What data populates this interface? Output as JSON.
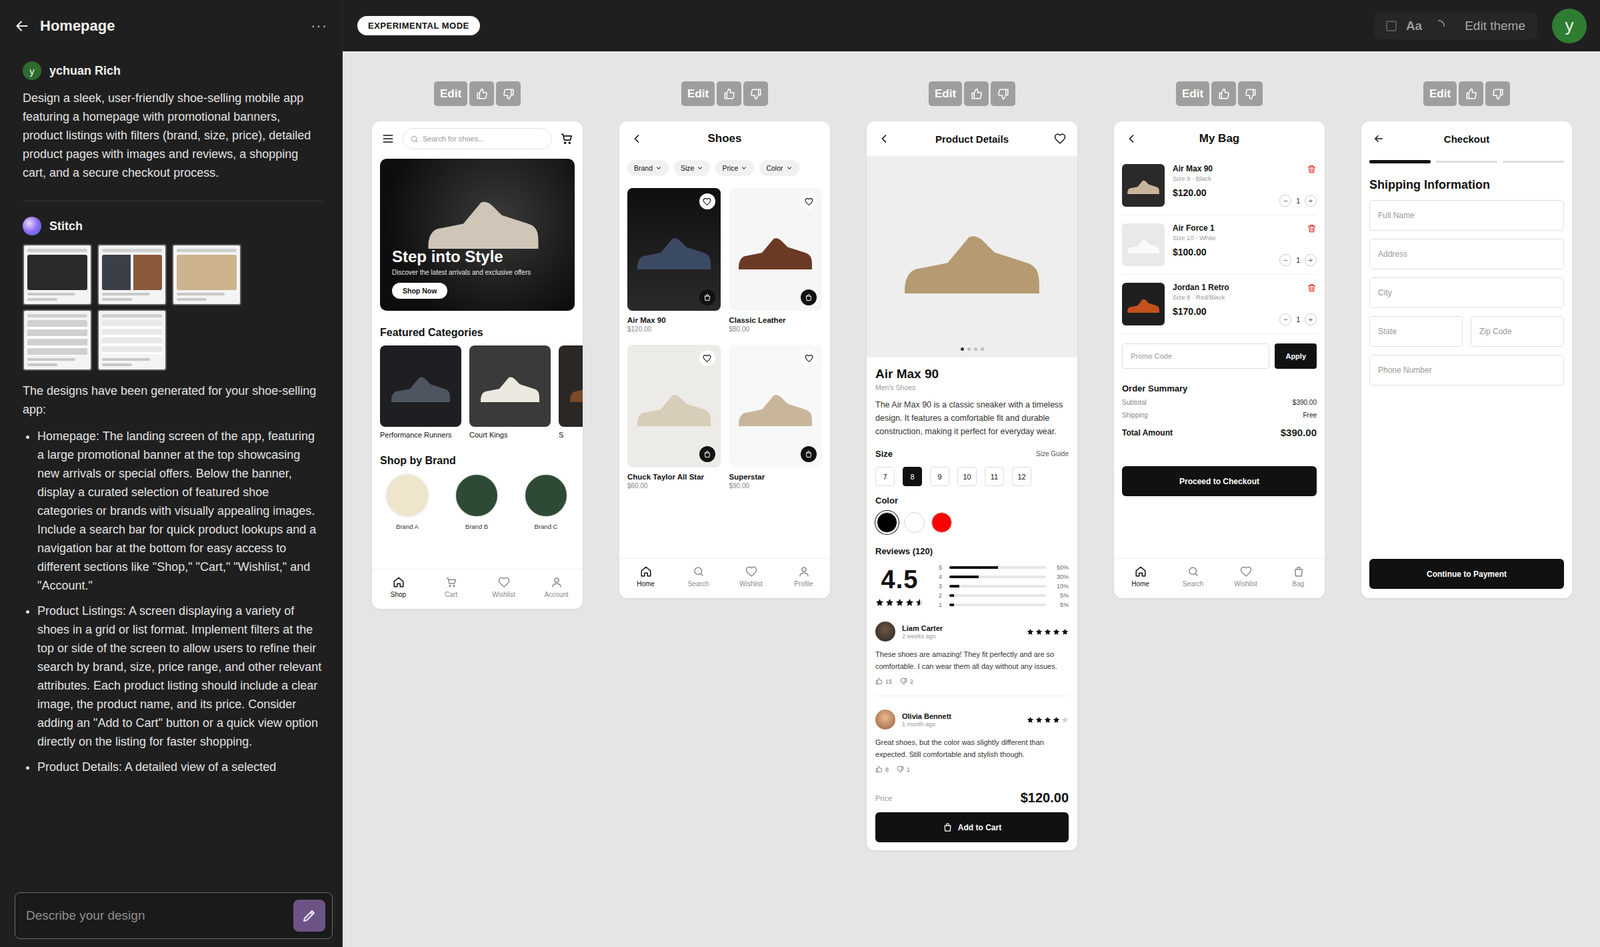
{
  "sidebar": {
    "title": "Homepage",
    "menu": "···",
    "user": {
      "avatar": "y",
      "name": "ychuan Rich",
      "prompt": "Design a sleek, user-friendly shoe-selling mobile app featuring a homepage with promotional banners, product listings with filters (brand, size, price), detailed product pages with images and reviews, a shopping cart, and a secure checkout process."
    },
    "assistant": {
      "name": "Stitch",
      "intro": "The designs have been generated for your shoe-selling app:",
      "bullets": [
        "Homepage: The landing screen of the app, featuring a large promotional banner at the top showcasing new arrivals or special offers. Below the banner, display a curated selection of featured shoe categories or brands with visually appealing images. Include a search bar for quick product lookups and a navigation bar at the bottom for easy access to different sections like \"Shop,\" \"Cart,\" \"Wishlist,\" and \"Account.\"",
        "Product Listings: A screen displaying a variety of shoes in a grid or list format. Implement filters at the top or side of the screen to allow users to refine their search by brand, size, price range, and other relevant attributes. Each product listing should include a clear image, the product name, and its price. Consider adding an \"Add to Cart\" button or a quick view option directly on the listing for faster shopping.",
        "Product Details: A detailed view of a selected"
      ]
    },
    "input": {
      "placeholder": "Describe your design"
    }
  },
  "topbar": {
    "badge": "EXPERIMENTAL MODE",
    "font_button": "Aa",
    "edit_theme": "Edit theme",
    "avatar": "y"
  },
  "screens": [
    {
      "kind": "home",
      "edit": "Edit",
      "search_placeholder": "Search for shoes...",
      "banner": {
        "title": "Step into Style",
        "subtitle": "Discover the latest arrivals and exclusive offers",
        "button": "Shop Now"
      },
      "categories_title": "Featured Categories",
      "categories": [
        {
          "name": "Performance Runners"
        },
        {
          "name": "Court Kings"
        },
        {
          "name": "S"
        }
      ],
      "brands_title": "Shop by Brand",
      "brands": [
        {
          "name": "Brand A",
          "color": "#efe4cc"
        },
        {
          "name": "Brand B",
          "color": "#2f4a34"
        },
        {
          "name": "Brand C",
          "color": "#2f4a34"
        }
      ],
      "nav": [
        {
          "label": "Shop",
          "kind": "home",
          "selected": true
        },
        {
          "label": "Cart",
          "kind": "cart",
          "selected": false
        },
        {
          "label": "Wishlist",
          "kind": "wishlist",
          "selected": false
        },
        {
          "label": "Account",
          "kind": "account",
          "selected": false
        }
      ]
    },
    {
      "kind": "listing",
      "edit": "Edit",
      "title": "Shoes",
      "filters": [
        "Brand",
        "Size",
        "Price",
        "Color"
      ],
      "products": [
        {
          "name": "Air Max 90",
          "price": "$120.00"
        },
        {
          "name": "Classic Leather",
          "price": "$80.00"
        },
        {
          "name": "Chuck Taylor All Star",
          "price": "$60.00"
        },
        {
          "name": "Superstar",
          "price": "$90.00"
        }
      ],
      "nav": [
        {
          "label": "Home",
          "kind": "home",
          "selected": true
        },
        {
          "label": "Search",
          "kind": "search",
          "selected": false
        },
        {
          "label": "Wishlist",
          "kind": "wishlist",
          "selected": false
        },
        {
          "label": "Profile",
          "kind": "profile",
          "selected": false
        }
      ]
    },
    {
      "kind": "details",
      "edit": "Edit",
      "title": "Product Details",
      "image_dots": [
        {
          "selected": true
        },
        {
          "selected": false
        },
        {
          "selected": false
        },
        {
          "selected": false
        }
      ],
      "name": "Air Max 90",
      "category": "Men's Shoes",
      "description": "The Air Max 90 is a classic sneaker with a timeless design. It features a comfortable fit and durable construction, making it perfect for everyday wear.",
      "size_label": "Size",
      "size_guide": "Size Guide",
      "sizes": [
        {
          "label": "7",
          "selected": false
        },
        {
          "label": "8",
          "selected": true
        },
        {
          "label": "9",
          "selected": false
        },
        {
          "label": "10",
          "selected": false
        },
        {
          "label": "11",
          "selected": false
        },
        {
          "label": "12",
          "selected": false
        }
      ],
      "color_label": "Color",
      "colors": [
        {
          "color": "#000000",
          "selected": true
        },
        {
          "color": "#ffffff",
          "selected": false
        },
        {
          "color": "#ff0000",
          "selected": false
        }
      ],
      "reviews_title": "Reviews (120)",
      "rating": "4.5",
      "rating_stars": 4.5,
      "distribution": [
        {
          "label": "5",
          "reading": "50%",
          "level": 0.5
        },
        {
          "label": "4",
          "reading": "30%",
          "level": 0.3
        },
        {
          "label": "3",
          "reading": "10%",
          "level": 0.1
        },
        {
          "label": "2",
          "reading": "5%",
          "level": 0.05
        },
        {
          "label": "1",
          "reading": "5%",
          "level": 0.05
        }
      ],
      "reviews": [
        {
          "name": "Liam Carter",
          "time": "2 weeks ago",
          "stars": 5,
          "text": "These shoes are amazing! They fit perfectly and are so comfortable. I can wear them all day without any issues.",
          "likes": "15",
          "dislikes": "2"
        },
        {
          "name": "Olivia Bennett",
          "time": "1 month ago",
          "stars": 4,
          "text": "Great shoes, but the color was slightly different than expected. Still comfortable and stylish though.",
          "likes": "8",
          "dislikes": "1"
        }
      ],
      "price_label": "Price",
      "price": "$120.00",
      "button": "Add to Cart"
    },
    {
      "kind": "bag",
      "edit": "Edit",
      "title": "My Bag",
      "stepper": {
        "minus": "−",
        "plus": "+"
      },
      "items": [
        {
          "name": "Air Max 90",
          "variant": "Size 9 · Black",
          "price": "$120.00",
          "qty": "1"
        },
        {
          "name": "Air Force 1",
          "variant": "Size 10 · White",
          "price": "$100.00",
          "qty": "1"
        },
        {
          "name": "Jordan 1 Retro",
          "variant": "Size 8 · Red/Black",
          "price": "$170.00",
          "qty": "1"
        }
      ],
      "promo_placeholder": "Promo Code",
      "apply": "Apply",
      "summary_title": "Order Summary",
      "summary": [
        {
          "label": "Subtotal",
          "value": "$390.00",
          "kind": "line"
        },
        {
          "label": "Shipping",
          "value": "Free",
          "kind": "line"
        },
        {
          "label": "Total Amount",
          "value": "$390.00",
          "kind": "total"
        }
      ],
      "button": "Proceed to Checkout",
      "nav": [
        {
          "label": "Home",
          "kind": "home",
          "selected": true
        },
        {
          "label": "Search",
          "kind": "search",
          "selected": false
        },
        {
          "label": "Wishlist",
          "kind": "wishlist",
          "selected": false
        },
        {
          "label": "Bag",
          "kind": "bag",
          "selected": false
        }
      ]
    },
    {
      "kind": "checkout",
      "edit": "Edit",
      "title": "Checkout",
      "steps": [
        {
          "selected": true
        },
        {
          "selected": false
        },
        {
          "selected": false
        }
      ],
      "section": "Shipping Information",
      "fields": [
        {
          "placeholder": "Full Name",
          "kind": "full"
        },
        {
          "placeholder": "Address",
          "kind": "full"
        },
        {
          "placeholder": "City",
          "kind": "full"
        },
        {
          "placeholder": "State",
          "kind": "half"
        },
        {
          "placeholder": "Zip Code",
          "kind": "half"
        },
        {
          "placeholder": "Phone Number",
          "kind": "full"
        }
      ],
      "button": "Continue to Payment"
    }
  ]
}
